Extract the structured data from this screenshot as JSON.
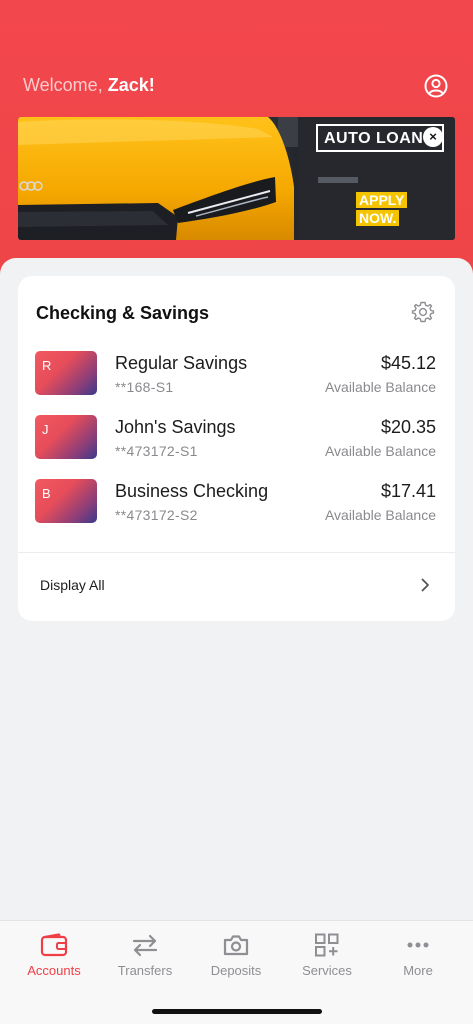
{
  "header": {
    "welcome_prefix": "Welcome, ",
    "user_name": "Zack!",
    "profile_icon": "user-circle-icon"
  },
  "banner": {
    "promo_title": "AUTO LOAN",
    "close_symbol": "×",
    "cta_line1": "APPLY",
    "cta_line2": "NOW."
  },
  "accounts_card": {
    "title": "Checking & Savings",
    "settings_icon": "gear-icon",
    "accounts": [
      {
        "initial": "R",
        "name": "Regular Savings",
        "number": "**168-S1",
        "balance": "$45.12",
        "balance_label": "Available Balance"
      },
      {
        "initial": "J",
        "name": "John's Savings",
        "number": "**473172-S1",
        "balance": "$20.35",
        "balance_label": "Available Balance"
      },
      {
        "initial": "B",
        "name": "Business Checking",
        "number": "**473172-S2",
        "balance": "$17.41",
        "balance_label": "Available Balance"
      }
    ],
    "display_all_label": "Display All"
  },
  "tabbar": {
    "active": "Accounts",
    "tabs": [
      {
        "label": "Accounts",
        "icon": "wallet-icon"
      },
      {
        "label": "Transfers",
        "icon": "transfer-arrows-icon"
      },
      {
        "label": "Deposits",
        "icon": "camera-icon"
      },
      {
        "label": "Services",
        "icon": "grid-plus-icon"
      },
      {
        "label": "More",
        "icon": "more-dots-icon"
      }
    ]
  },
  "colors": {
    "brand_red": "#ef4448",
    "accent": "#ef3f45",
    "background": "#f1f2f4",
    "muted_text": "#8a8a8e"
  }
}
